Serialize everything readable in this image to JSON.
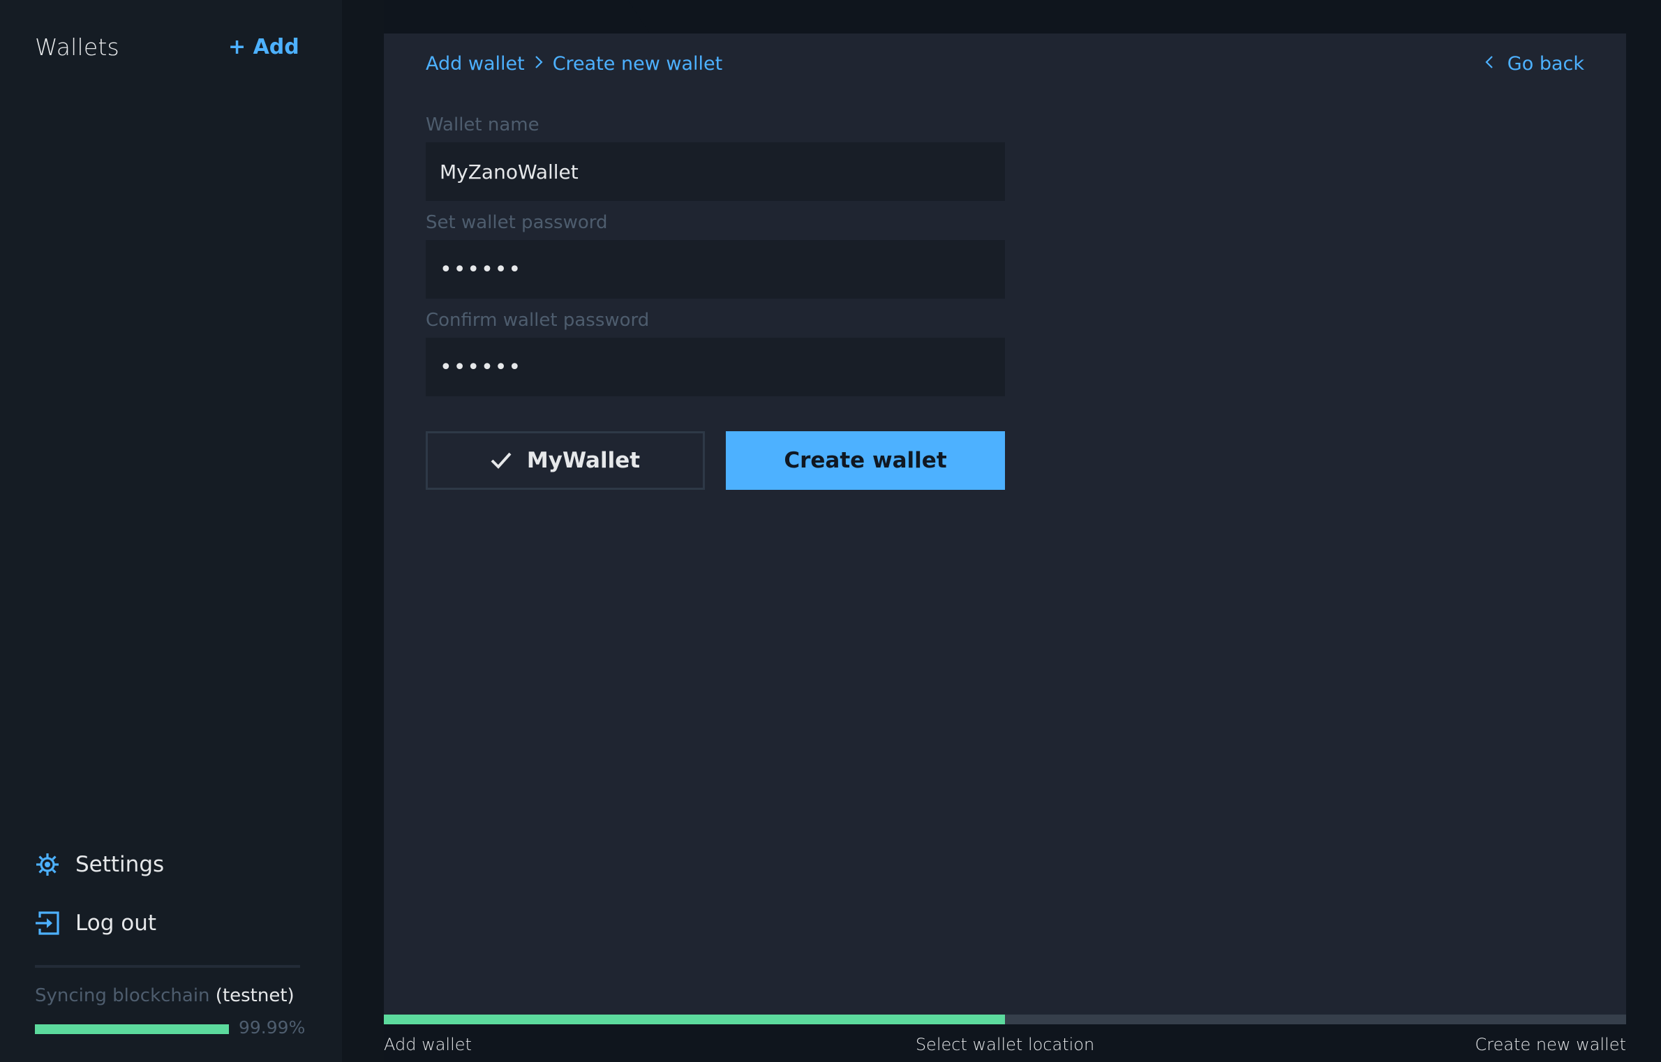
{
  "sidebar": {
    "title": "Wallets",
    "add_label": "+ Add",
    "nav": [
      {
        "label": "Settings",
        "icon": "gear-icon"
      },
      {
        "label": "Log out",
        "icon": "logout-icon"
      }
    ],
    "sync": {
      "label": "Syncing blockchain",
      "network": "(testnet)",
      "percent_text": "99.99%",
      "progress": 0.9999
    }
  },
  "main": {
    "breadcrumb": [
      "Add wallet",
      "Create new wallet"
    ],
    "breadcrumb_separator_icon": "chevron-right-icon",
    "go_back_label": "Go back",
    "form": {
      "wallet_name_label": "Wallet name",
      "wallet_name_value": "MyZanoWallet",
      "password_label": "Set wallet password",
      "password_value": "••••••",
      "confirm_label": "Confirm wallet password",
      "confirm_value": "••••••",
      "save_file_button": "MyWallet",
      "create_button": "Create wallet"
    }
  },
  "steps": {
    "labels": [
      "Add wallet",
      "Select wallet location",
      "Create new wallet"
    ],
    "progress": 0.5
  },
  "colors": {
    "accent": "#4db1ff",
    "success": "#5cda9d",
    "panel": "#1f2531",
    "sidebar": "#151c24"
  }
}
